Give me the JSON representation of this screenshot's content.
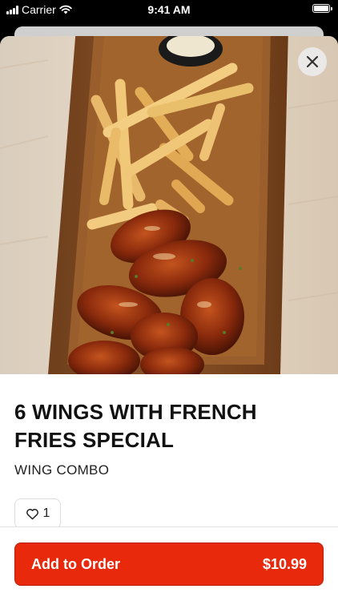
{
  "status_bar": {
    "carrier": "Carrier",
    "time": "9:41 AM"
  },
  "item": {
    "title": "6 WINGS WITH FRENCH FRIES SPECIAL",
    "category": "WING COMBO",
    "likes": "1"
  },
  "order": {
    "button_label": "Add to Order",
    "price": "$10.99"
  },
  "icons": {
    "close": "close-icon",
    "like": "heart-icon",
    "wifi": "wifi-icon",
    "signal": "signal-icon",
    "battery": "battery-icon"
  },
  "colors": {
    "accent": "#e8290b"
  }
}
